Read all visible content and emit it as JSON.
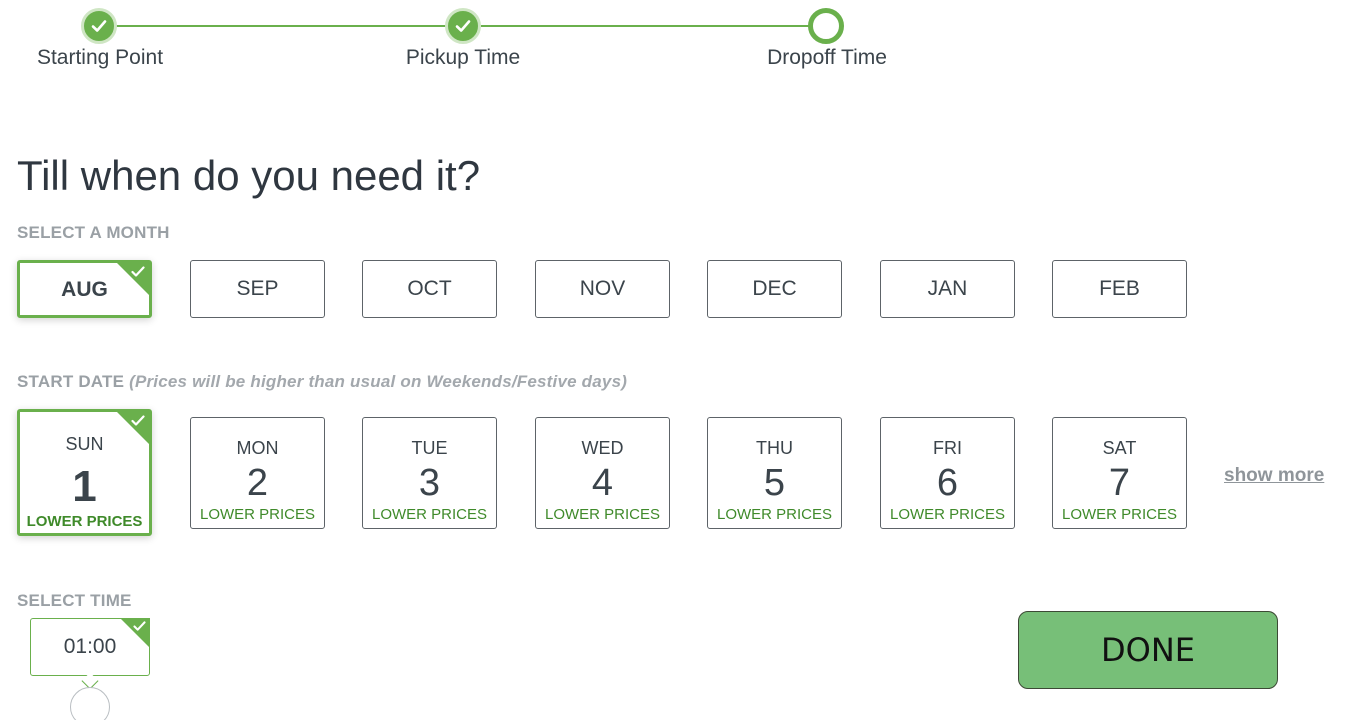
{
  "stepper": {
    "steps": [
      {
        "label": "Starting Point",
        "status": "done"
      },
      {
        "label": "Pickup Time",
        "status": "done"
      },
      {
        "label": "Dropoff Time",
        "status": "current"
      }
    ],
    "accent": "#6ab04c"
  },
  "title": "Till when do you need it?",
  "months": {
    "label": "SELECT A MONTH",
    "options": [
      "AUG",
      "SEP",
      "OCT",
      "NOV",
      "DEC",
      "JAN",
      "FEB"
    ],
    "selected": "AUG"
  },
  "dates": {
    "label": "START DATE",
    "note": "(Prices will be higher than usual on Weekends/Festive days)",
    "options": [
      {
        "dow": "SUN",
        "day": "1",
        "price": "LOWER PRICES"
      },
      {
        "dow": "MON",
        "day": "2",
        "price": "LOWER PRICES"
      },
      {
        "dow": "TUE",
        "day": "3",
        "price": "LOWER PRICES"
      },
      {
        "dow": "WED",
        "day": "4",
        "price": "LOWER PRICES"
      },
      {
        "dow": "THU",
        "day": "5",
        "price": "LOWER PRICES"
      },
      {
        "dow": "FRI",
        "day": "6",
        "price": "LOWER PRICES"
      },
      {
        "dow": "SAT",
        "day": "7",
        "price": "LOWER PRICES"
      }
    ],
    "selected_index": 0,
    "show_more": "show more"
  },
  "time": {
    "label": "SELECT TIME",
    "value": "01:00"
  },
  "done_label": "DONE"
}
